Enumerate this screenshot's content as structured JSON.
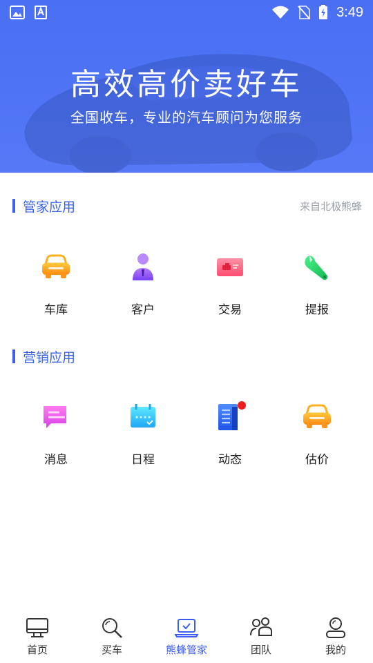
{
  "status_bar": {
    "time": "3:49"
  },
  "banner": {
    "title": "高效高价卖好车",
    "subtitle": "全国收车，专业的汽车顾问为您服务"
  },
  "sections": [
    {
      "title": "管家应用",
      "extra": "来自北极熊蜂",
      "items": [
        {
          "label": "车库",
          "icon": "car-icon"
        },
        {
          "label": "客户",
          "icon": "customer-icon"
        },
        {
          "label": "交易",
          "icon": "trade-icon"
        },
        {
          "label": "提报",
          "icon": "wrench-icon"
        }
      ]
    },
    {
      "title": "营销应用",
      "items": [
        {
          "label": "消息",
          "icon": "message-icon"
        },
        {
          "label": "日程",
          "icon": "calendar-icon"
        },
        {
          "label": "动态",
          "icon": "news-icon"
        },
        {
          "label": "估价",
          "icon": "car-icon"
        }
      ]
    }
  ],
  "bottom_nav": {
    "active": "熊蜂管家",
    "items": [
      {
        "label": "首页",
        "icon": "monitor-icon"
      },
      {
        "label": "买车",
        "icon": "search-icon"
      },
      {
        "label": "熊蜂管家",
        "icon": "laptop-check-icon"
      },
      {
        "label": "团队",
        "icon": "team-icon"
      },
      {
        "label": "我的",
        "icon": "profile-icon"
      }
    ]
  },
  "colors": {
    "brand_blue": "#4a6ff3",
    "section_title": "#3a63e6",
    "badge_red": "#ee1c1c"
  }
}
